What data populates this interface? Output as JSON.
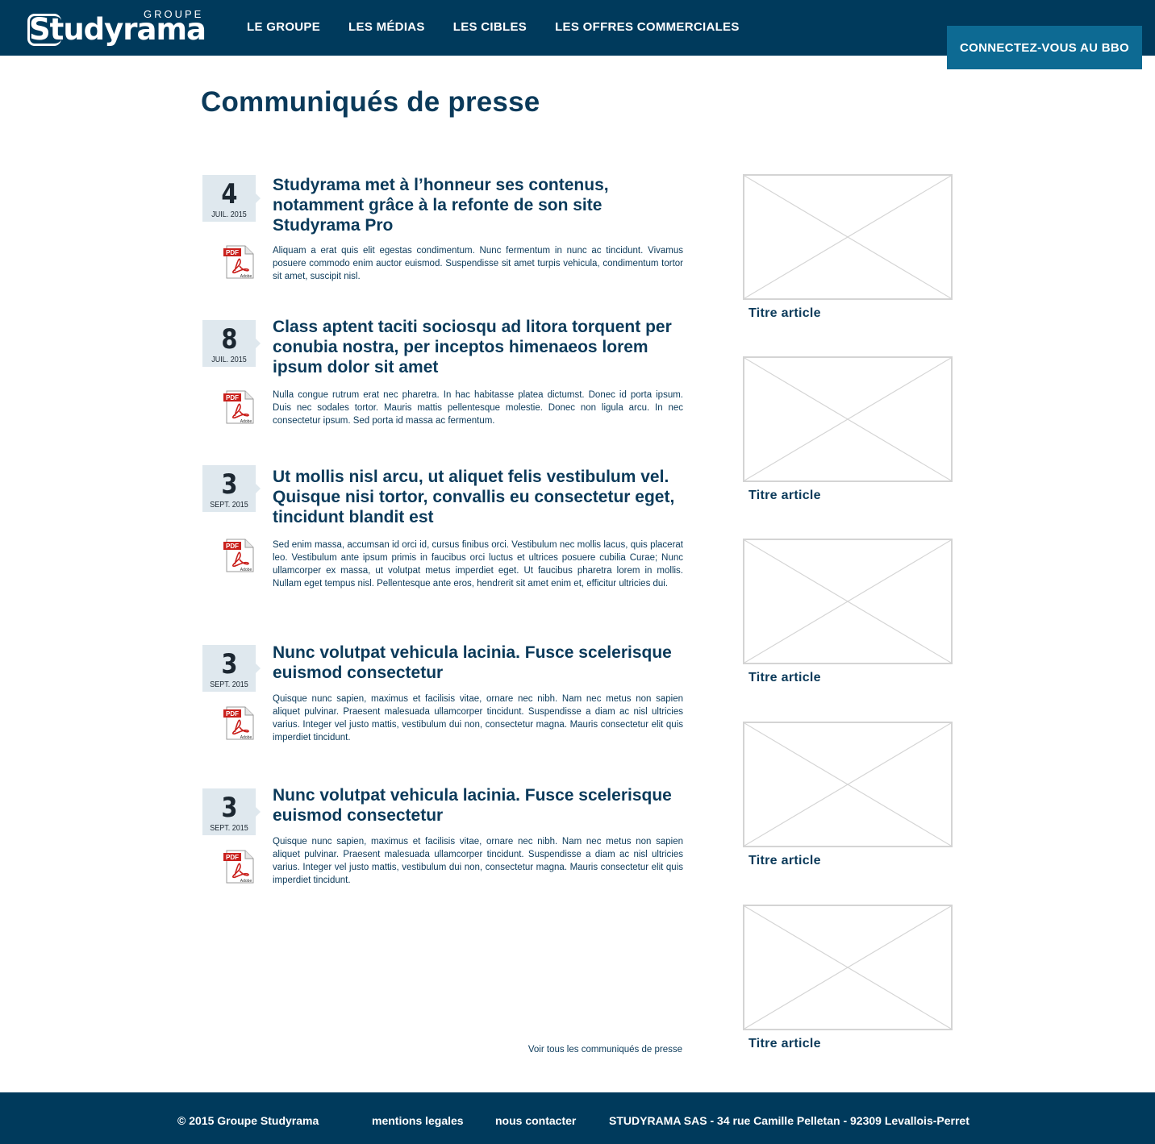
{
  "header": {
    "logo": {
      "groupe": "GROUPE",
      "word": "Studyrama"
    },
    "nav": [
      "LE GROUPE",
      "LES MÉDIAS",
      "LES CIBLES",
      "LES OFFRES COMMERCIALES"
    ],
    "bbo_button": "CONNECTEZ-VOUS AU BBO"
  },
  "page_title": "Communiqués de presse",
  "press_items": [
    {
      "day": "4",
      "month": "JUIL. 2015",
      "title": "Studyrama met à l’honneur ses contenus, notamment grâce à la refonte de son site Studyrama Pro",
      "text": "Aliquam a erat quis elit egestas condimentum. Nunc fermentum in nunc ac tincidunt. Vivamus posuere commodo enim auctor euismod. Suspendisse sit amet turpis vehicula, condimentum tortor sit amet, suscipit nisl."
    },
    {
      "day": "8",
      "month": "JUIL. 2015",
      "title": "Class aptent taciti sociosqu ad litora torquent per conubia nostra, per inceptos himenaeos lorem ipsum dolor sit amet",
      "text": "Nulla congue rutrum erat nec pharetra. In hac habitasse platea dictumst. Donec id porta ipsum. Duis nec sodales tortor. Mauris mattis pellentesque molestie. Donec non ligula arcu. In nec consectetur ipsum. Sed porta id massa ac fermentum."
    },
    {
      "day": "3",
      "month": "SEPT. 2015",
      "title": "Ut mollis nisl arcu, ut aliquet felis vestibulum vel. Quisque nisi tortor, convallis eu consectetur eget, tincidunt blandit est",
      "text": "Sed enim massa, accumsan id orci id, cursus finibus orci. Vestibulum nec mollis lacus, quis placerat leo. Vestibulum ante ipsum primis in faucibus orci luctus et ultrices posuere cubilia Curae; Nunc ullamcorper ex massa, ut volutpat metus imperdiet eget. Ut faucibus pharetra lorem in mollis. Nullam eget tempus nisl. Pellentesque ante eros, hendrerit sit amet enim et, efficitur ultricies dui."
    },
    {
      "day": "3",
      "month": "SEPT. 2015",
      "title": "Nunc volutpat vehicula lacinia. Fusce scelerisque euismod consectetur",
      "text": "Quisque nunc sapien, maximus et facilisis vitae, ornare nec nibh. Nam nec metus non sapien aliquet pulvinar. Praesent malesuada ullamcorper tincidunt. Suspendisse a diam ac nisl ultricies varius. Integer vel justo mattis, vestibulum dui non, consectetur magna. Mauris consectetur elit quis imperdiet tincidunt."
    },
    {
      "day": "3",
      "month": "SEPT. 2015",
      "title": "Nunc volutpat vehicula lacinia. Fusce scelerisque euismod consectetur",
      "text": "Quisque nunc sapien, maximus et facilisis vitae, ornare nec nibh. Nam nec metus non sapien aliquet pulvinar. Praesent malesuada ullamcorper tincidunt. Suspendisse a diam ac nisl ultricies varius. Integer vel justo mattis, vestibulum dui non, consectetur magna. Mauris consectetur elit quis imperdiet tincidunt."
    }
  ],
  "pdf_icon": {
    "label": "PDF",
    "brand": "Adobe"
  },
  "see_all": "Voir tous les communiqués de presse",
  "side_articles": [
    "Titre article",
    "Titre article",
    "Titre article",
    "Titre article",
    "Titre article"
  ],
  "footer": {
    "copyright": "© 2015 Groupe Studyrama",
    "legal": "mentions legales",
    "contact": "nous contacter",
    "address": "STUDYRAMA SAS - 34 rue Camille Pelletan - 92309 Levallois-Perret"
  },
  "colors": {
    "header_bg": "#003a5c",
    "bbo_button_bg": "#0d6a93",
    "text_primary": "#0b3a5a",
    "date_box_bg": "#dfe8ee",
    "pdf_red": "#c9201c"
  }
}
